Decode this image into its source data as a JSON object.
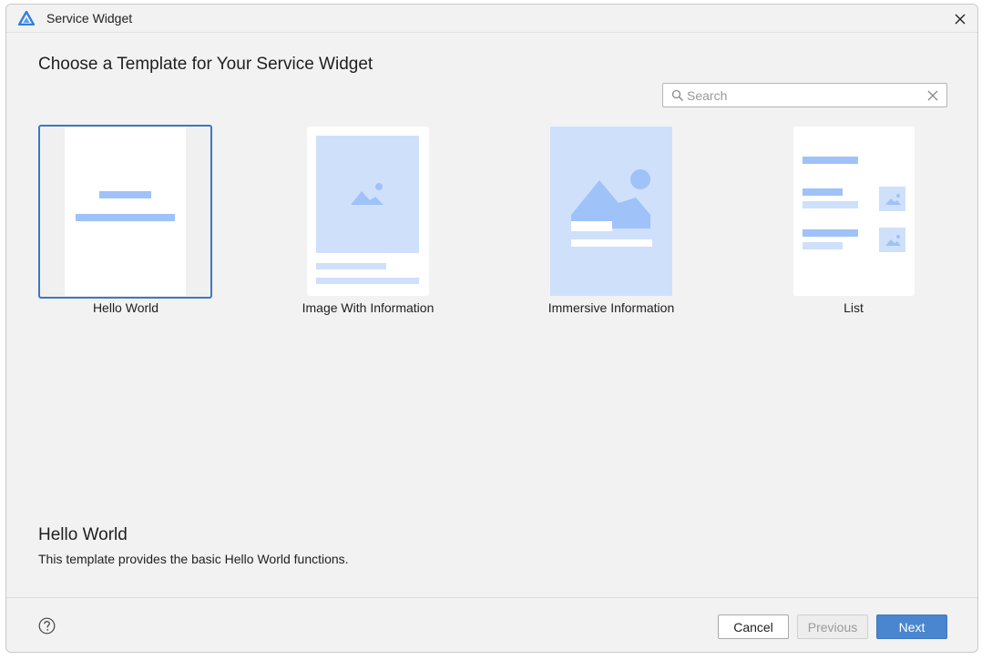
{
  "window": {
    "title": "Service Widget"
  },
  "page": {
    "heading": "Choose a Template for Your Service Widget"
  },
  "search": {
    "placeholder": "Search",
    "value": ""
  },
  "templates": [
    {
      "label": "Hello World",
      "selected": true
    },
    {
      "label": "Image With Information",
      "selected": false
    },
    {
      "label": "Immersive Information",
      "selected": false
    },
    {
      "label": "List",
      "selected": false
    }
  ],
  "description": {
    "title": "Hello World",
    "text": "This template provides the basic Hello World functions."
  },
  "footer": {
    "cancel_label": "Cancel",
    "previous_label": "Previous",
    "next_label": "Next",
    "previous_enabled": false
  },
  "colors": {
    "accent": "#4a86cf",
    "selection_border": "#3b78c4",
    "preview_fill": "#cfe0fb",
    "preview_shape": "#9fc2f8",
    "window_bg": "#f2f2f2"
  },
  "icons": {
    "app": "app-logo-icon",
    "close": "close-icon",
    "search": "search-icon",
    "clear": "clear-icon",
    "help": "help-icon",
    "image_placeholder": "image-placeholder-icon"
  }
}
